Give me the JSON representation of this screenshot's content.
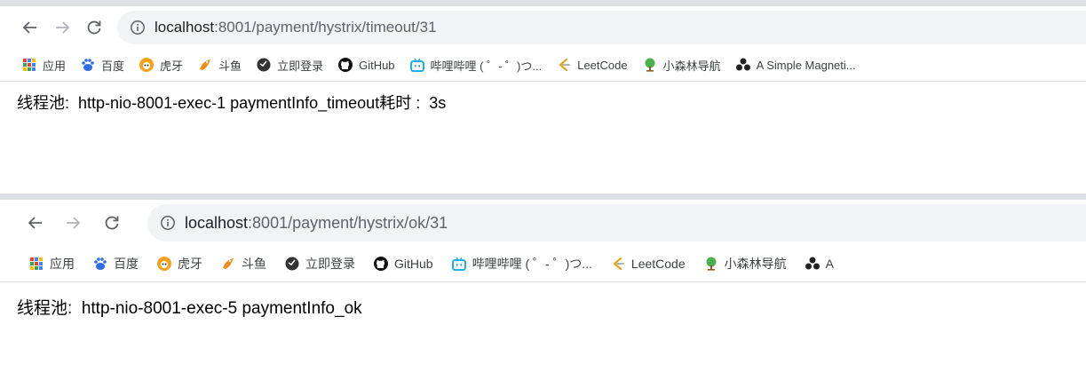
{
  "windows": [
    {
      "url_host": "localhost",
      "url_path": ":8001/payment/hystrix/timeout/31",
      "bookmarks": [
        {
          "icon": "apps-grid-icon",
          "label": "应用"
        },
        {
          "icon": "baidu-paw-icon",
          "label": "百度"
        },
        {
          "icon": "huya-icon",
          "label": "虎牙"
        },
        {
          "icon": "douyu-fish-icon",
          "label": "斗鱼"
        },
        {
          "icon": "dark-globe-icon",
          "label": "立即登录"
        },
        {
          "icon": "github-icon",
          "label": "GitHub"
        },
        {
          "icon": "bilibili-tv-icon",
          "label": "哔哩哔哩 ( ゜- ゜)つ..."
        },
        {
          "icon": "leetcode-icon",
          "label": "LeetCode"
        },
        {
          "icon": "tree-icon",
          "label": "小森林导航"
        },
        {
          "icon": "magnet-icon",
          "label": "A Simple Magneti..."
        }
      ],
      "page_text": "线程池:  http-nio-8001-exec-1 paymentInfo_timeout耗时 :  3s"
    },
    {
      "url_host": "localhost",
      "url_path": ":8001/payment/hystrix/ok/31",
      "bookmarks": [
        {
          "icon": "apps-grid-icon",
          "label": "应用"
        },
        {
          "icon": "baidu-paw-icon",
          "label": "百度"
        },
        {
          "icon": "huya-icon",
          "label": "虎牙"
        },
        {
          "icon": "douyu-fish-icon",
          "label": "斗鱼"
        },
        {
          "icon": "dark-globe-icon",
          "label": "立即登录"
        },
        {
          "icon": "github-icon",
          "label": "GitHub"
        },
        {
          "icon": "bilibili-tv-icon",
          "label": "哔哩哔哩 ( ゜- ゜)つ..."
        },
        {
          "icon": "leetcode-icon",
          "label": "LeetCode"
        },
        {
          "icon": "tree-icon",
          "label": "小森林导航"
        },
        {
          "icon": "magnet-icon",
          "label": "A"
        }
      ],
      "page_text": "线程池:  http-nio-8001-exec-5 paymentInfo_ok"
    }
  ]
}
